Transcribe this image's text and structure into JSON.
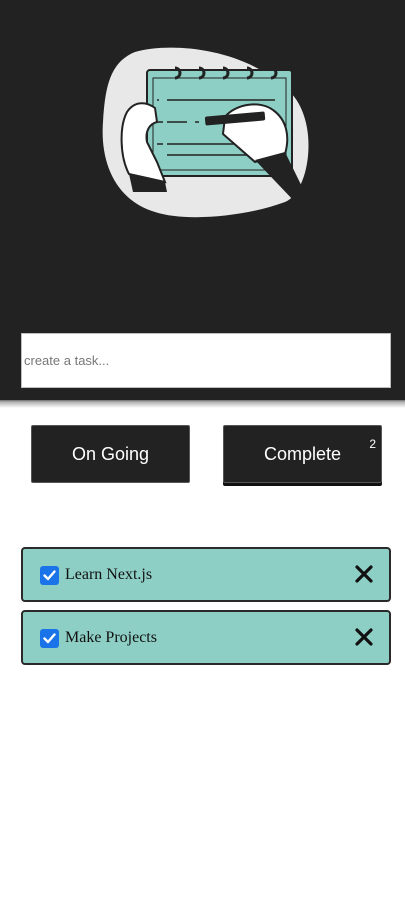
{
  "input": {
    "placeholder": "create a task..."
  },
  "tabs": {
    "ongoing_label": "On Going",
    "complete_label": "Complete",
    "complete_count": "2"
  },
  "tasks": [
    {
      "label": "Learn Next.js",
      "checked": true
    },
    {
      "label": "Make Projects",
      "checked": true
    }
  ],
  "colors": {
    "background_dark": "#222222",
    "task_card": "#8ecfc5",
    "checkbox": "#1a73e8"
  },
  "icons": {
    "illustration": "hand-writing-notepad",
    "check": "check-icon",
    "delete": "close-icon"
  }
}
